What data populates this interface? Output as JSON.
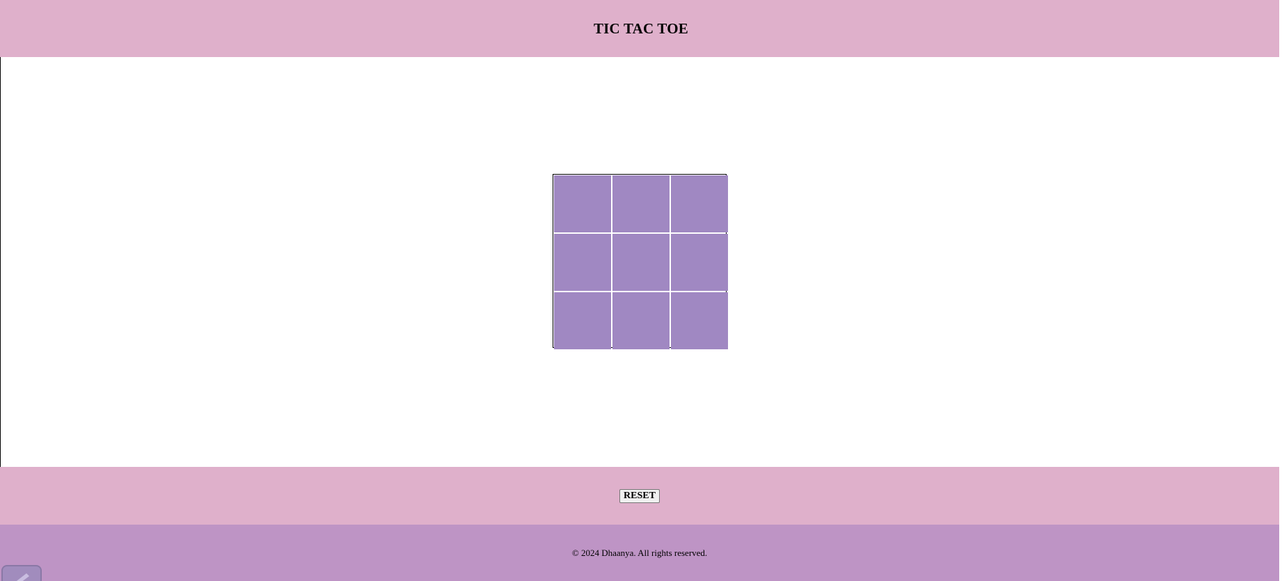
{
  "header": {
    "title": "TIC TAC TOE"
  },
  "board": {
    "cells": [
      "",
      "",
      "",
      "",
      "",
      "",
      "",
      "",
      ""
    ]
  },
  "controls": {
    "reset_label": "RESET"
  },
  "footer": {
    "copyright": "© 2024 Dhaanya. All rights reserved."
  },
  "colors": {
    "header_bg": "#dfb0cb",
    "cell_bg": "#a088c2",
    "footer_bg": "#be94c5"
  },
  "icons": {
    "corner": "edit-icon"
  }
}
